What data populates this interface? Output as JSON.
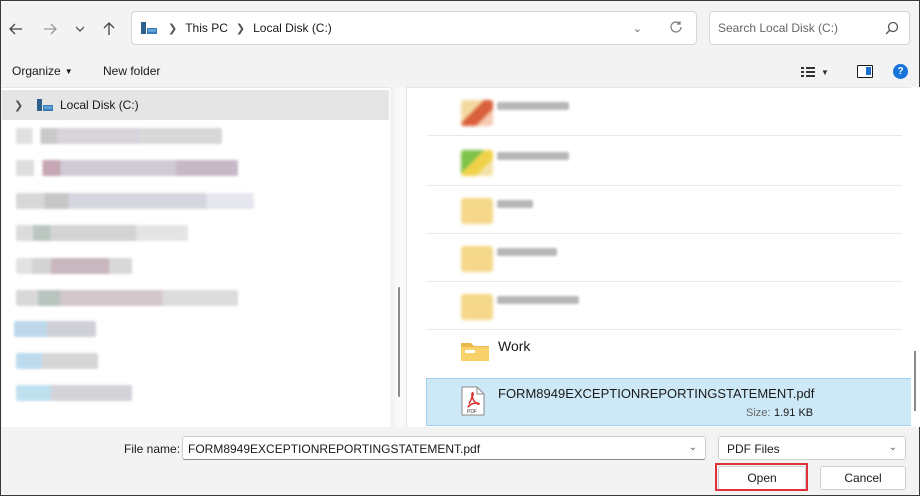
{
  "toolbar": {
    "back_icon": "arrow-left-icon",
    "forward_icon": "arrow-right-icon",
    "recent_icon": "chevron-down-icon",
    "up_icon": "arrow-up-icon"
  },
  "address": {
    "root_icon": "this-pc-icon",
    "crumbs": [
      "This PC",
      "Local Disk (C:)"
    ],
    "refresh_icon": "refresh-icon"
  },
  "search": {
    "placeholder": "Search Local Disk (C:)",
    "icon": "search-icon"
  },
  "commands": {
    "organize_label": "Organize",
    "new_folder_label": "New folder",
    "view_icon": "list-view-icon",
    "preview_icon": "preview-pane-icon",
    "help_label": "?"
  },
  "nav": {
    "selected_label": "Local Disk (C:)",
    "selected_icon": "drive-icon"
  },
  "files": {
    "work_folder": "Work",
    "selected_file": {
      "name": "FORM8949EXCEPTIONREPORTINGSTATEMENT.pdf",
      "size_label": "Size:",
      "size_value": "1.91 KB",
      "icon": "pdf-icon"
    }
  },
  "footer": {
    "filename_label": "File name:",
    "filename_value": "FORM8949EXCEPTIONREPORTINGSTATEMENT.pdf",
    "filetype_value": "PDF Files",
    "open_label": "Open",
    "cancel_label": "Cancel"
  },
  "colors": {
    "selection": "#cde8f7",
    "accent": "#1a73d9",
    "highlight_border": "#e0303a"
  }
}
